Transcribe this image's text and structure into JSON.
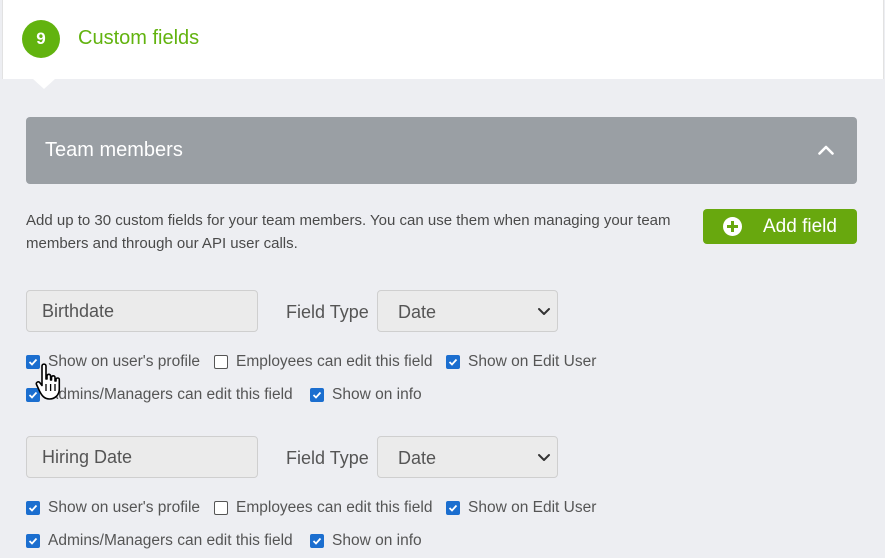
{
  "step": {
    "number": "9",
    "title": "Custom fields"
  },
  "panel": {
    "title": "Team members"
  },
  "description": "Add up to 30 custom fields for your team members. You can use them when managing your team members and through our API user calls.",
  "add_button": {
    "label": "Add field"
  },
  "field_type_label": "Field Type",
  "fields": [
    {
      "name": "Birthdate",
      "type": "Date",
      "options": {
        "show_on_profile": {
          "label": "Show on user's profile",
          "checked": true
        },
        "employees_edit": {
          "label": "Employees can edit this field",
          "checked": false
        },
        "show_on_edit_user": {
          "label": "Show on Edit User",
          "checked": true
        },
        "admins_edit": {
          "label": "Admins/Managers can edit this field",
          "checked": true
        },
        "show_on_info": {
          "label": "Show on info",
          "checked": true
        }
      }
    },
    {
      "name": "Hiring Date",
      "type": "Date",
      "options": {
        "show_on_profile": {
          "label": "Show on user's profile",
          "checked": true
        },
        "employees_edit": {
          "label": "Employees can edit this field",
          "checked": false
        },
        "show_on_edit_user": {
          "label": "Show on Edit User",
          "checked": true
        },
        "admins_edit": {
          "label": "Admins/Managers can edit this field",
          "checked": true
        },
        "show_on_info": {
          "label": "Show on info",
          "checked": true
        }
      }
    }
  ],
  "colors": {
    "accent_green": "#62b30f",
    "button_green": "#68a80e",
    "checkbox_blue": "#1b6ecf",
    "panel_gray": "#9a9fa4"
  }
}
